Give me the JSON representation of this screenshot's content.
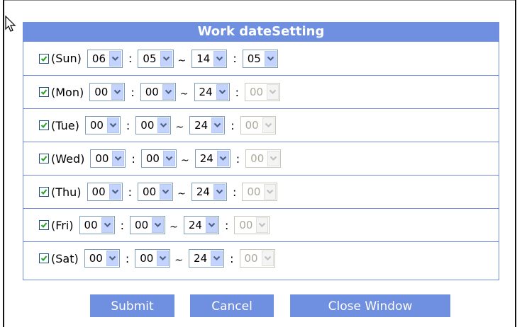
{
  "panel": {
    "title": "Work dateSetting"
  },
  "days": [
    {
      "label": "(Sun)",
      "checked": true,
      "start_hour": "06",
      "start_min": "05",
      "end_hour": "14",
      "end_min": "05",
      "end_min_disabled": false
    },
    {
      "label": "(Mon)",
      "checked": true,
      "start_hour": "00",
      "start_min": "00",
      "end_hour": "24",
      "end_min": "00",
      "end_min_disabled": true
    },
    {
      "label": "(Tue)",
      "checked": true,
      "start_hour": "00",
      "start_min": "00",
      "end_hour": "24",
      "end_min": "00",
      "end_min_disabled": true
    },
    {
      "label": "(Wed)",
      "checked": true,
      "start_hour": "00",
      "start_min": "00",
      "end_hour": "24",
      "end_min": "00",
      "end_min_disabled": true
    },
    {
      "label": "(Thu)",
      "checked": true,
      "start_hour": "00",
      "start_min": "00",
      "end_hour": "24",
      "end_min": "00",
      "end_min_disabled": true
    },
    {
      "label": "(Fri)",
      "checked": true,
      "start_hour": "00",
      "start_min": "00",
      "end_hour": "24",
      "end_min": "00",
      "end_min_disabled": true
    },
    {
      "label": "(Sat)",
      "checked": true,
      "start_hour": "00",
      "start_min": "00",
      "end_hour": "24",
      "end_min": "00",
      "end_min_disabled": true
    }
  ],
  "separators": {
    "colon": ":",
    "tilde": "~"
  },
  "buttons": {
    "submit": "Submit",
    "cancel": "Cancel",
    "close": "Close Window"
  },
  "colors": {
    "header_bg": "#6f8fe0",
    "row_border": "#6f8ad8",
    "button_bg": "#6f8fe0"
  }
}
